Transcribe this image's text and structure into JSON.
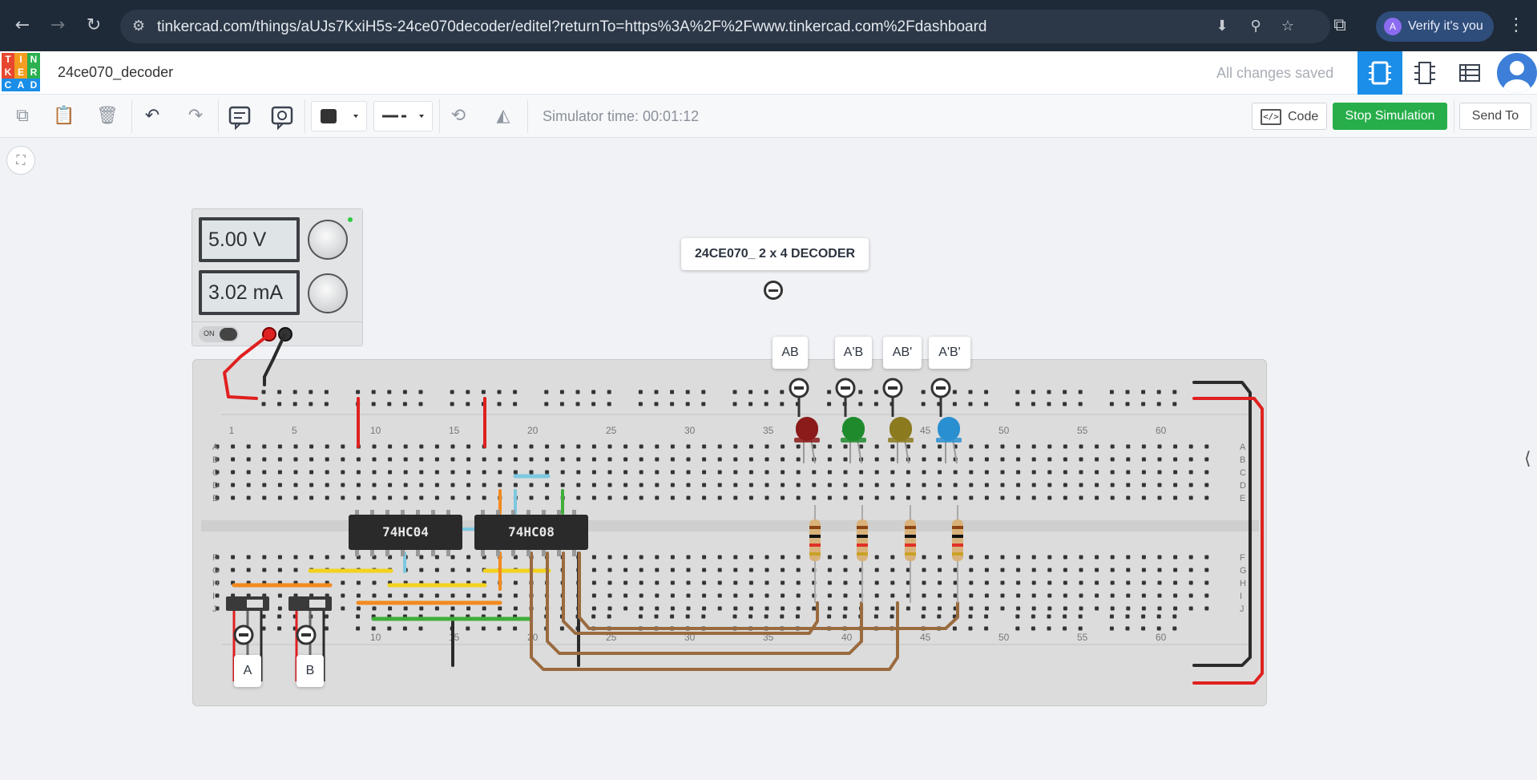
{
  "browser": {
    "url": "tinkercad.com/things/aUJs7KxiH5s-24ce070decoder/editel?returnTo=https%3A%2F%2Fwww.tinkercad.com%2Fdashboard",
    "verify_label": "Verify it's you",
    "verify_avatar": "A"
  },
  "logo": {
    "letters": [
      "T",
      "I",
      "N",
      "K",
      "E",
      "R",
      "C",
      "A",
      "D"
    ],
    "colors": [
      "#e8472f",
      "#f39c1f",
      "#2ab04f",
      "#e8472f",
      "#f39c1f",
      "#2ab04f",
      "#1a8ee8",
      "#1a8ee8",
      "#1a8ee8"
    ]
  },
  "header": {
    "project_name": "24ce070_decoder",
    "save_status": "All changes saved"
  },
  "toolbar": {
    "sim_time": "Simulator time: 00:01:12",
    "code_label": "Code",
    "stop_label": "Stop Simulation",
    "send_label": "Send To"
  },
  "psu": {
    "voltage": "5.00 V",
    "current": "3.02 mA",
    "on_label": "ON"
  },
  "title_label": "24CE070_ 2 x 4 DECODER",
  "led_labels": [
    "AB",
    "A'B",
    "AB'",
    "A'B'"
  ],
  "led_colors": [
    "#8b1a1a",
    "#1e8a2c",
    "#8b7a1e",
    "#2a8fd0"
  ],
  "switch_labels": [
    "A",
    "B"
  ],
  "chips": [
    "74HC04",
    "74HC08"
  ],
  "breadboard": {
    "column_numbers": [
      "1",
      "5",
      "10",
      "15",
      "20",
      "25",
      "30",
      "35",
      "40",
      "45",
      "50",
      "55",
      "60"
    ],
    "row_letters_top": [
      "A",
      "B",
      "C",
      "D",
      "E"
    ],
    "row_letters_bottom": [
      "F",
      "G",
      "H",
      "I",
      "J"
    ]
  },
  "colors": {
    "accent": "#1a8ee8",
    "stop": "#27ae4a",
    "wire_red": "#e02020",
    "wire_black": "#2b2b2b"
  }
}
